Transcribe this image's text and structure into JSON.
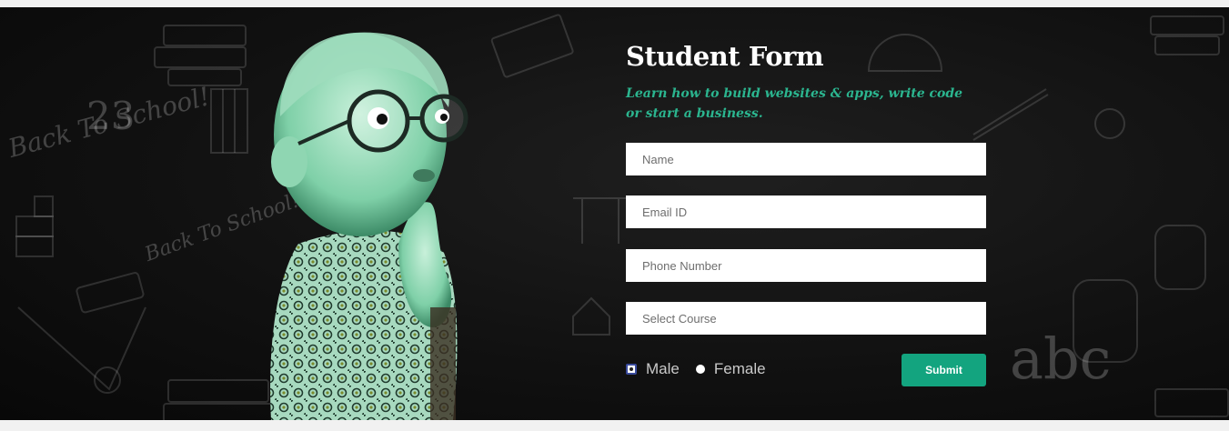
{
  "form": {
    "title": "Student Form",
    "subtitle": "Learn how to build websites & apps, write code or start a business.",
    "fields": {
      "name_placeholder": "Name",
      "email_placeholder": "Email ID",
      "phone_placeholder": "Phone Number",
      "course_placeholder": "Select Course"
    },
    "gender": {
      "options": [
        "Male",
        "Female"
      ],
      "selected": "Male"
    },
    "submit_label": "Submit"
  },
  "background": {
    "chalk_text": [
      "Back To School!",
      "Back To School!",
      "23"
    ],
    "abc_text": "abc"
  },
  "colors": {
    "accent": "#13a47f",
    "subtitle": "#2bb58f",
    "banner_bg": "#111111",
    "page_bg": "#f1f1f1"
  }
}
